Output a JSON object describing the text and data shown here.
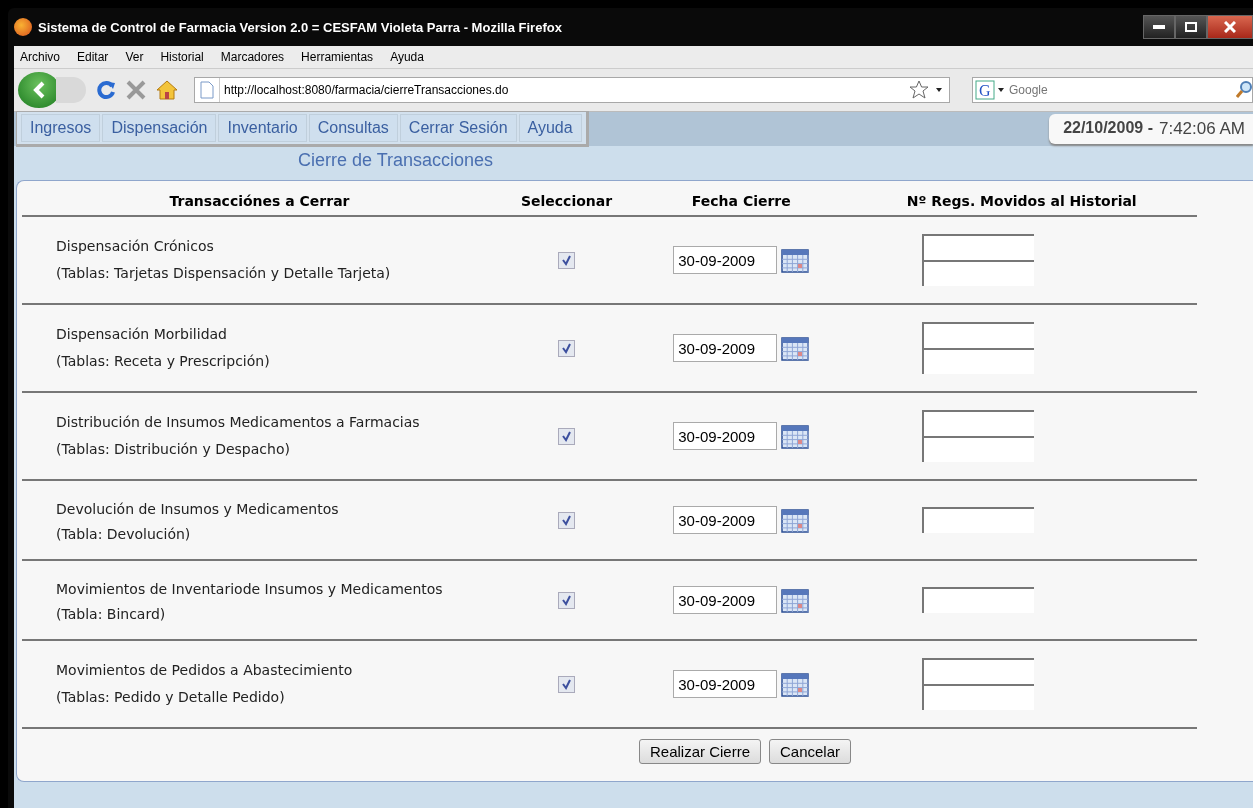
{
  "window": {
    "title": "Sistema de Control de Farmacia Version 2.0 = CESFAM Violeta Parra - Mozilla Firefox"
  },
  "menu_bar": [
    "Archivo",
    "Editar",
    "Ver",
    "Historial",
    "Marcadores",
    "Herramientas",
    "Ayuda"
  ],
  "address_bar": {
    "value": "http://localhost:8080/farmacia/cierreTransacciones.do"
  },
  "search_field": {
    "engine_letter": "G",
    "placeholder": "Google"
  },
  "nav_menu": [
    "Ingresos",
    "Dispensación",
    "Inventario",
    "Consultas",
    "Cerrar Sesión",
    "Ayuda"
  ],
  "clock": {
    "date": "22/10/2009 -",
    "time": "7:42:06 AM"
  },
  "page_title": "Cierre de Transacciones",
  "table": {
    "columns": [
      "Transacciónes a Cerrar",
      "Seleccionar",
      "Fecha Cierre",
      "Nº Regs. Movidos al Historial"
    ],
    "rows": [
      {
        "name": "Dispensación Crónicos",
        "tables": "(Tablas: Tarjetas Dispensación y Detalle Tarjeta)",
        "checked": true,
        "date": "30-09-2009",
        "kind": "double"
      },
      {
        "name": "Dispensación Morbilidad",
        "tables": "(Tablas: Receta y Prescripción)",
        "checked": true,
        "date": "30-09-2009",
        "kind": "double"
      },
      {
        "name": "Distribución de Insumos Medicamentos a Farmacias",
        "tables": "(Tablas: Distribución y Despacho)",
        "checked": true,
        "date": "30-09-2009",
        "kind": "double"
      },
      {
        "name": "Devolución de Insumos y Medicamentos",
        "tables": "(Tabla: Devolución)",
        "checked": true,
        "date": "30-09-2009",
        "kind": "single"
      },
      {
        "name": "Movimientos de Inventariode Insumos y Medicamentos",
        "tables": "(Tabla: Bincard)",
        "checked": true,
        "date": "30-09-2009",
        "kind": "single"
      },
      {
        "name": "Movimientos de Pedidos a Abastecimiento",
        "tables": "(Tablas: Pedido y Detalle Pedido)",
        "checked": true,
        "date": "30-09-2009",
        "kind": "double"
      }
    ]
  },
  "buttons": [
    "Realizar Cierre",
    "Cancelar"
  ]
}
